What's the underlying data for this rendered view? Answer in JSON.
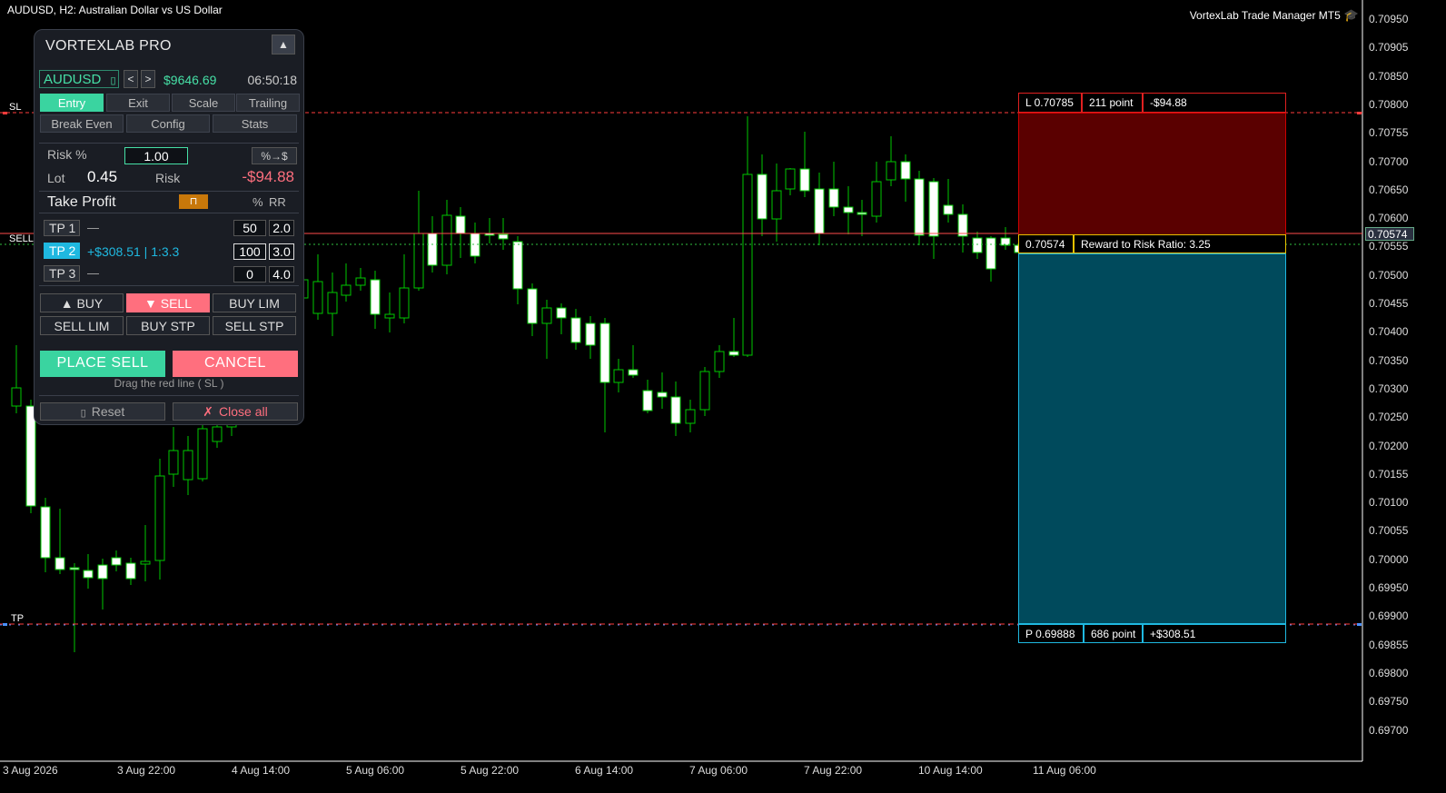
{
  "chart": {
    "symbol_title": "AUDUSD, H2:  Australian Dollar vs US Dollar",
    "ea_name": "VortexLab Trade Manager MT5",
    "ea_icon": "graduation-cap-icon",
    "current_price_tag": "0.70574",
    "line_labels": {
      "sl": "SL",
      "sell": "SELL",
      "tp": "TP"
    },
    "colors": {
      "bull": "#00c800",
      "bear_body": "#ffffff",
      "sl_line": "#ff3b3b",
      "tp_line": "#4a90ff",
      "risk_zone": "#5a0000",
      "reward_zone": "#004a5c"
    }
  },
  "price_axis": [
    "0.70950",
    "0.70905",
    "0.70850",
    "0.70800",
    "0.70755",
    "0.70700",
    "0.70650",
    "0.70600",
    "0.70555",
    "0.70500",
    "0.70455",
    "0.70400",
    "0.70350",
    "0.70300",
    "0.70250",
    "0.70200",
    "0.70155",
    "0.70100",
    "0.70055",
    "0.70000",
    "0.69950",
    "0.69900",
    "0.69855",
    "0.69800",
    "0.69750",
    "0.69700"
  ],
  "time_axis": [
    "3 Aug 2026",
    "3 Aug 22:00",
    "4 Aug 14:00",
    "5 Aug 06:00",
    "5 Aug 22:00",
    "6 Aug 14:00",
    "7 Aug 06:00",
    "7 Aug 22:00",
    "10 Aug 14:00",
    "11 Aug 06:00"
  ],
  "sl_box": {
    "price": "L 0.70785",
    "points": "211 point",
    "money": "-$94.88"
  },
  "entry_box": {
    "price": "0.70574",
    "ratio": "Reward to Risk Ratio:  3.25"
  },
  "tp_box": {
    "price": "P 0.69888",
    "points": "686 point",
    "money": "+$308.51"
  },
  "panel": {
    "title": "VORTEXLAB PRO",
    "collapse": "▲",
    "symbol": "AUDUSD",
    "symbol_icon": "copy-icon",
    "prev": "<",
    "next": ">",
    "balance": "$9646.69",
    "clock": "06:50:18",
    "tabs": [
      "Entry",
      "Exit",
      "Scale",
      "Trailing"
    ],
    "tabs2": [
      "Break Even",
      "Config",
      "Stats"
    ],
    "risk_label": "Risk %",
    "risk_value": "1.00",
    "risk_toggle": "%→$",
    "lot_label": "Lot",
    "lot_value": "0.45",
    "risk_text": "Risk",
    "risk_money": "-$94.88",
    "tp_title": "Take Profit",
    "lock_icon": "lock-icon",
    "pct_header": "%",
    "rr_header": "RR",
    "tps": [
      {
        "label": "TP 1",
        "info": "—",
        "pct": "50",
        "rr": "2.0"
      },
      {
        "label": "TP 2",
        "info": "+$308.51 | 1:3.3",
        "pct": "100",
        "rr": "3.0"
      },
      {
        "label": "TP 3",
        "info": "—",
        "pct": "0",
        "rr": "4.0"
      }
    ],
    "orders": [
      "▲  BUY",
      "▼  SELL",
      "BUY LIM",
      "SELL LIM",
      "BUY STP",
      "SELL STP"
    ],
    "place": "PLACE  SELL",
    "cancel": "CANCEL",
    "hint": "Drag the red line  ( SL )",
    "reset": "Reset",
    "reset_icon": "reset-icon",
    "closeall": "Close all",
    "closeall_icon": "x-icon"
  }
}
